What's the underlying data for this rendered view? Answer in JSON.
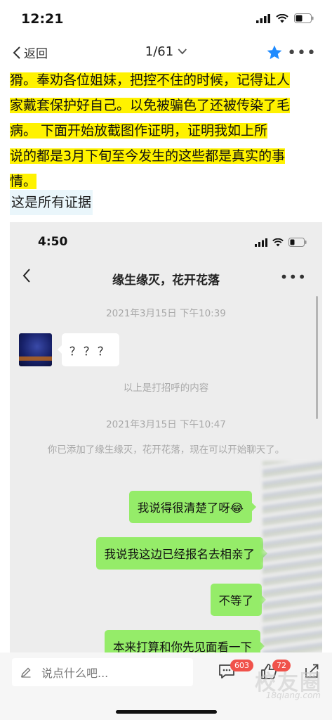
{
  "status": {
    "time": "12:21"
  },
  "nav": {
    "back_label": "返回",
    "page_indicator": "1/61"
  },
  "article": {
    "lines": [
      "猾。奉劝各位姐妹，把控不住的时候，记得让人",
      "家戴套保护好自己。以免被骗色了还被传染了毛",
      "病。  下面开始放截图作证明，证明我如上所",
      "说的都是3月下旬至今发生的这些都是真实的事",
      "情。"
    ],
    "evidence_label": "这是所有证据"
  },
  "screenshot": {
    "time": "4:50",
    "chat_title": "缘生缘灭，花开花落",
    "timestamp1": "2021年3月15日 下午10:39",
    "left_message": "？？？",
    "note": "以上是打招呼的内容",
    "timestamp2": "2021年3月15日 下午10:47",
    "added_notice": "你已添加了缘生缘灭，花开花落，现在可以开始聊天了。",
    "messages": [
      "我说得很清楚了呀😂",
      "我说我这边已经报名去相亲了",
      "不等了",
      "本来打算和你先见面看一下"
    ]
  },
  "bottom": {
    "comment_placeholder": "说点什么吧...",
    "comment_count": "603",
    "like_count": "72",
    "watermark": "校友圈",
    "watermark_site": "18qiang.com"
  },
  "colors": {
    "highlight": "#fff200",
    "bubble_green": "#95ec69",
    "star": "#1f8bff",
    "badge": "#f0524b"
  }
}
